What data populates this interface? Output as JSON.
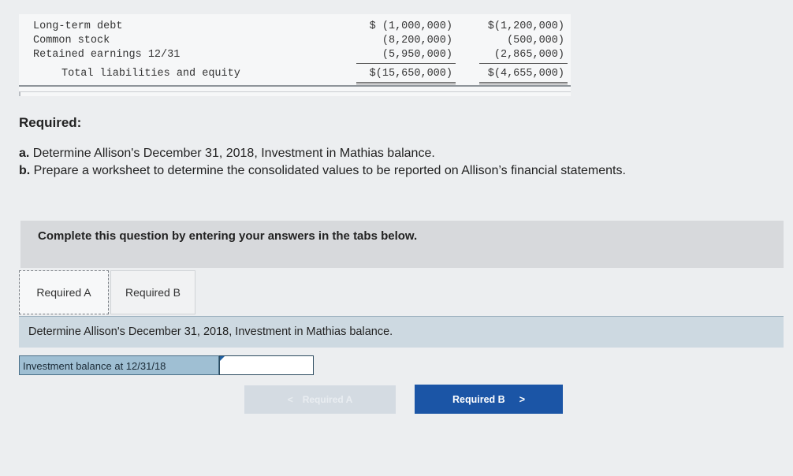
{
  "financials": {
    "rows": [
      {
        "label": "Long-term debt",
        "v1": "$ (1,000,000)",
        "v2": "$(1,200,000)"
      },
      {
        "label": "Common stock",
        "v1": "(8,200,000)",
        "v2": "(500,000)"
      },
      {
        "label": "Retained earnings 12/31",
        "v1": "(5,950,000)",
        "v2": "(2,865,000)"
      },
      {
        "label": "Total liabilities and equity",
        "v1": "$(15,650,000)",
        "v2": "$(4,655,000)"
      }
    ]
  },
  "required": {
    "heading": "Required:",
    "items": [
      {
        "letter": "a.",
        "text": "Determine Allison's December 31, 2018, Investment in Mathias balance."
      },
      {
        "letter": "b.",
        "text": "Prepare a worksheet to determine the consolidated values to be reported on Allison’s financial statements."
      }
    ]
  },
  "complete_bar": {
    "text": "Complete this question by entering your answers in the tabs below."
  },
  "tabs": [
    {
      "label": "Required A",
      "active": true
    },
    {
      "label": "Required B",
      "active": false
    }
  ],
  "instruction": "Determine Allison's December 31, 2018, Investment in Mathias balance.",
  "investment_row": {
    "label": "Investment balance at 12/31/18",
    "value": ""
  },
  "nav": {
    "prev_label": "Required A",
    "prev_arrow": "<",
    "next_label": "Required B",
    "next_arrow": ">"
  }
}
